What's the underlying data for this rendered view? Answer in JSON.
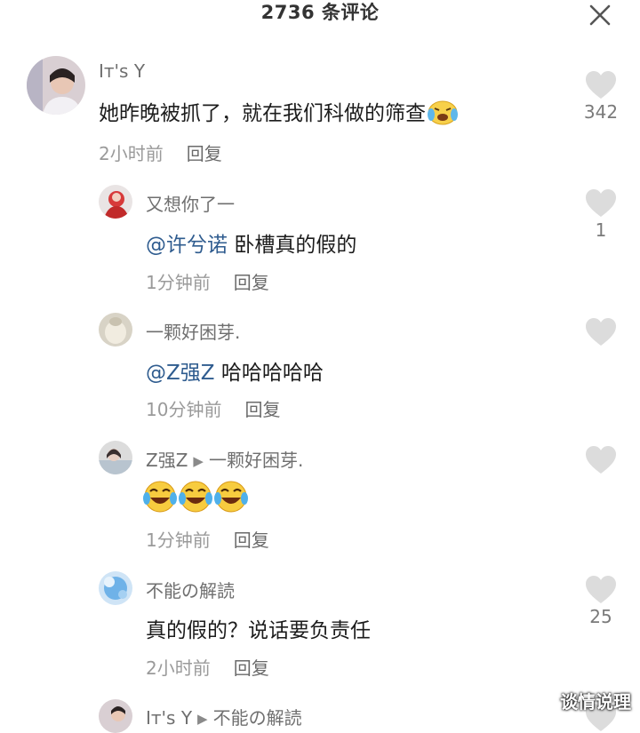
{
  "header": {
    "title": "2736 条评论",
    "close_icon": "close-icon"
  },
  "comments": [
    {
      "username": "Iт's Y",
      "text": "她昨晚被抓了，就在我们科做的筛查",
      "emoji": "crying-laughing-emoji",
      "time": "2小时前",
      "reply": "回复",
      "likes": "342"
    },
    {
      "username": "又想你了一",
      "mention": "@许兮诺",
      "text": "卧槽真的假的",
      "time": "1分钟前",
      "reply": "回复",
      "likes": "1"
    },
    {
      "username": "一颗好困芽.",
      "mention": "@Z强Z",
      "text": "哈哈哈哈哈",
      "time": "10分钟前",
      "reply": "回复",
      "likes": ""
    },
    {
      "username": "Z强Z",
      "reply_to": "一颗好困芽.",
      "emoji": "laughing-emoji-x3",
      "time": "1分钟前",
      "reply": "回复",
      "likes": ""
    },
    {
      "username": "不能の解読",
      "text": "真的假的？说话要负责任",
      "time": "2小时前",
      "reply": "回复",
      "likes": "25"
    },
    {
      "username": "Iт's Y",
      "reply_to": "不能の解読"
    }
  ],
  "watermark": "谈情说理",
  "colors": {
    "mention": "#2f5c8f",
    "heart": "#dcdcdc",
    "meta": "#9a9a9a"
  }
}
